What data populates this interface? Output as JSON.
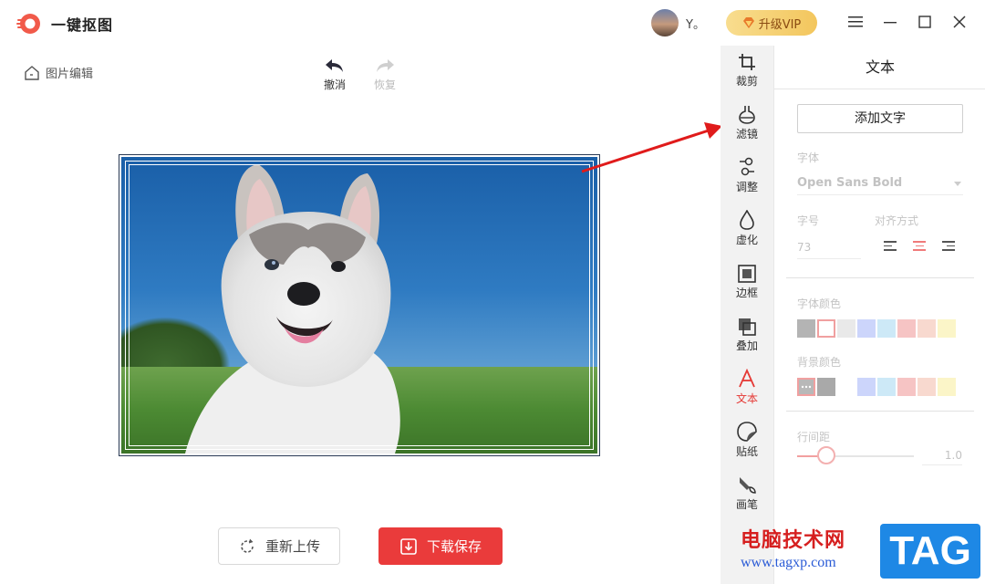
{
  "app": {
    "title": "一键抠图"
  },
  "user": {
    "name": "Y。"
  },
  "vip": {
    "label": "升级VIP"
  },
  "breadcrumb": {
    "label": "图片编辑"
  },
  "history": {
    "undo": "撤消",
    "redo": "恢复",
    "undo_enabled": true,
    "redo_enabled": false
  },
  "actions": {
    "reupload": "重新上传",
    "save": "下载保存"
  },
  "tools": [
    {
      "id": "crop",
      "label": "裁剪",
      "icon": "crop-icon"
    },
    {
      "id": "filter",
      "label": "滤镜",
      "icon": "filter-icon"
    },
    {
      "id": "adjust",
      "label": "调整",
      "icon": "adjust-icon"
    },
    {
      "id": "blur",
      "label": "虚化",
      "icon": "blur-drop-icon"
    },
    {
      "id": "border",
      "label": "边框",
      "icon": "border-frame-icon"
    },
    {
      "id": "overlay",
      "label": "叠加",
      "icon": "overlay-icon"
    },
    {
      "id": "text",
      "label": "文本",
      "icon": "text-a-icon",
      "active": true
    },
    {
      "id": "sticker",
      "label": "贴纸",
      "icon": "sticker-icon"
    },
    {
      "id": "brush",
      "label": "画笔",
      "icon": "brush-icon"
    }
  ],
  "panel": {
    "title": "文本",
    "add_text": "添加文字",
    "font_label": "字体",
    "font_value": "Open Sans Bold",
    "size_label": "字号",
    "size_value": "73",
    "align_label": "对齐方式",
    "align_selected": "center",
    "font_color_label": "字体颜色",
    "font_colors": [
      "#b4b4b4",
      "#ffffff",
      "#e9e9e9",
      "#ccd5fb",
      "#cde9f7",
      "#f6c4c4",
      "#f8d9cf",
      "#fbf5c8"
    ],
    "font_color_selected_index": 1,
    "bg_color_label": "背景颜色",
    "bg_colors": [
      "#b8b8b8",
      "#a9a9a9",
      "#ffffff",
      "#ccd5fb",
      "#cde9f7",
      "#f6c4c4",
      "#f8d9cf",
      "#fbf5c8"
    ],
    "bg_color_selected_index": 0,
    "line_spacing_label": "行间距",
    "line_spacing_value": "1.0",
    "line_spacing_level": 0.25
  },
  "watermark": {
    "site": "电脑技术网",
    "url": "www.tagxp.com",
    "tag": "TAG"
  },
  "colors": {
    "accent": "#ea3b3b",
    "active_tool": "#e53935",
    "rail_bg": "#f2f2f2"
  }
}
